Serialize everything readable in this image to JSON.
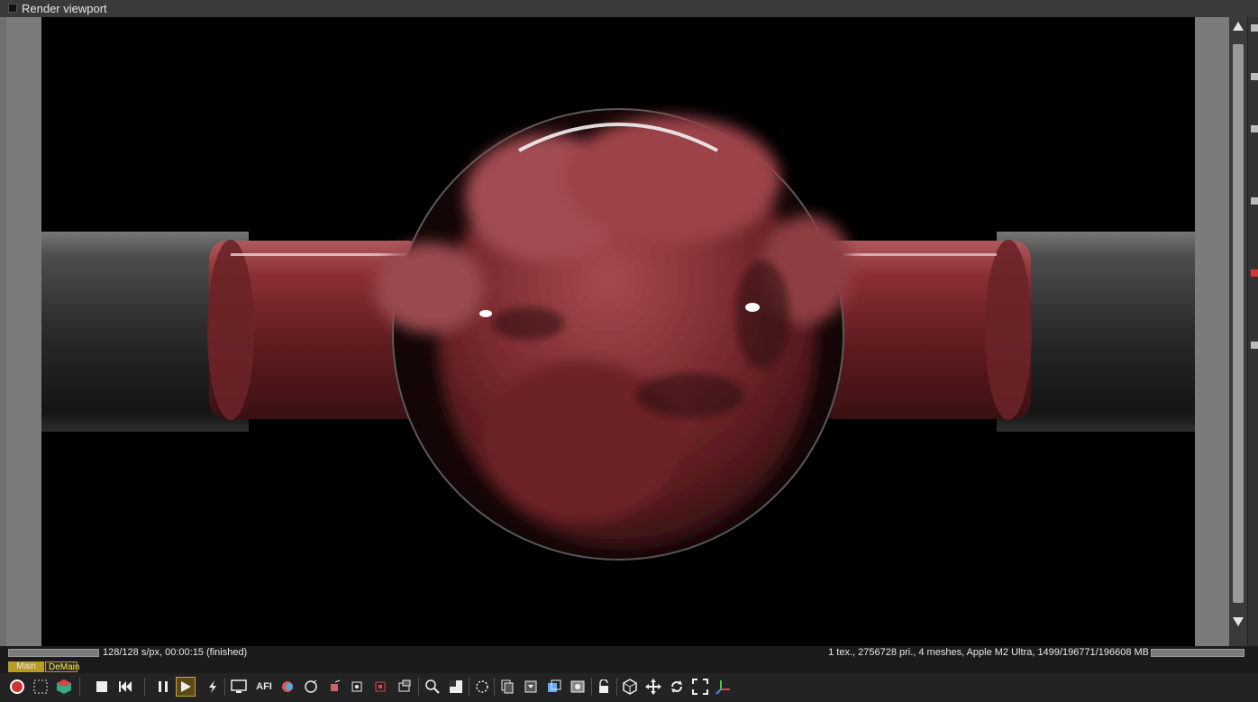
{
  "window": {
    "title": "Render viewport"
  },
  "status": {
    "left_text": "128/128 s/px, 00:00:15 (finished)",
    "right_text": "1 tex., 2756728 pri., 4 meshes, Apple M2 Ultra, 1499/196771/196608 MB",
    "progress_left": 1.0,
    "progress_right": 1.0
  },
  "tabs": [
    {
      "label": "Main"
    },
    {
      "label": "DeMain"
    }
  ],
  "toolbar": {
    "icons": [
      "render-settings-icon",
      "region-render-icon",
      "cube-color-icon",
      "stop-icon",
      "restart-icon",
      "pause-icon",
      "play-icon",
      "lightning-icon",
      "display-icon",
      "afi-icon",
      "color-picker-icon",
      "material-picker-icon",
      "object-picker-icon",
      "focus-picker-icon",
      "white-balance-icon",
      "region-picker-icon",
      "zoom-icon",
      "channel-icon",
      "denoise-icon",
      "copy-icon",
      "save-icon",
      "export-icon",
      "clay-icon",
      "lock-icon",
      "box-view-icon",
      "move-icon",
      "rotate-icon",
      "fit-icon",
      "axis-icon"
    ],
    "afi_label": "AFI"
  },
  "colors": {
    "accent": "#b99b25",
    "render_bg": "#000000"
  }
}
